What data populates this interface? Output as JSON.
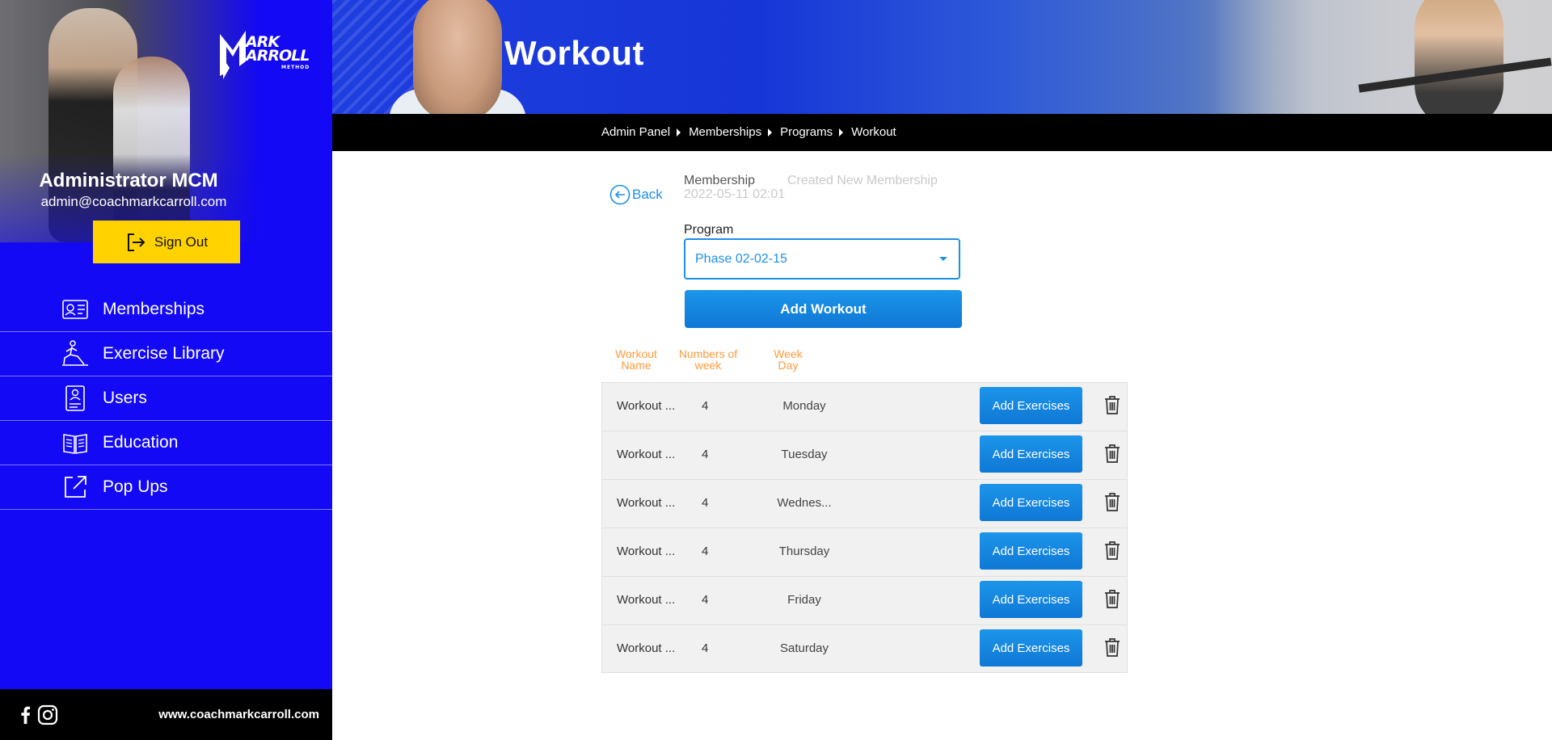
{
  "brand": {
    "logo_text_line1": "ARK",
    "logo_text_line2": "ARROLL",
    "logo_sub": "METHOD",
    "accent_color": "#1309f4",
    "button_color": "#1e8fe8",
    "signout_color": "#ffd200",
    "heading_accent": "#ff9a3c"
  },
  "user": {
    "name": "Administrator MCM",
    "email": "admin@coachmarkcarroll.com",
    "signout_label": "Sign Out"
  },
  "nav": {
    "items": [
      {
        "label": "Memberships",
        "icon": "membership-card-icon"
      },
      {
        "label": "Exercise Library",
        "icon": "exercise-lunge-icon"
      },
      {
        "label": "Users",
        "icon": "user-document-icon"
      },
      {
        "label": "Education",
        "icon": "book-icon"
      },
      {
        "label": "Pop Ups",
        "icon": "external-link-icon"
      }
    ]
  },
  "footer": {
    "site_url": "www.coachmarkcarroll.com",
    "social": [
      "facebook-icon",
      "instagram-icon"
    ]
  },
  "header": {
    "title": "Workout",
    "breadcrumb": [
      "Admin Panel",
      "Memberships",
      "Programs",
      "Workout"
    ]
  },
  "main": {
    "back_label": "Back",
    "membership_label": "Membership",
    "membership_name": "Created New Membership",
    "membership_date": "2022-05-11 02:01",
    "program_label": "Program",
    "program_selected": "Phase 02-02-15",
    "add_workout_label": "Add Workout",
    "columns": {
      "name": "Workout Name",
      "weeks": "Numbers of week",
      "day": "Week Day"
    },
    "add_exercises_label": "Add Exercises",
    "rows": [
      {
        "name": "Workout ...",
        "weeks": "4",
        "day": "Monday"
      },
      {
        "name": "Workout ...",
        "weeks": "4",
        "day": "Tuesday"
      },
      {
        "name": "Workout ...",
        "weeks": "4",
        "day": "Wednes..."
      },
      {
        "name": "Workout ...",
        "weeks": "4",
        "day": "Thursday"
      },
      {
        "name": "Workout ...",
        "weeks": "4",
        "day": "Friday"
      },
      {
        "name": "Workout ...",
        "weeks": "4",
        "day": "Saturday"
      }
    ]
  }
}
